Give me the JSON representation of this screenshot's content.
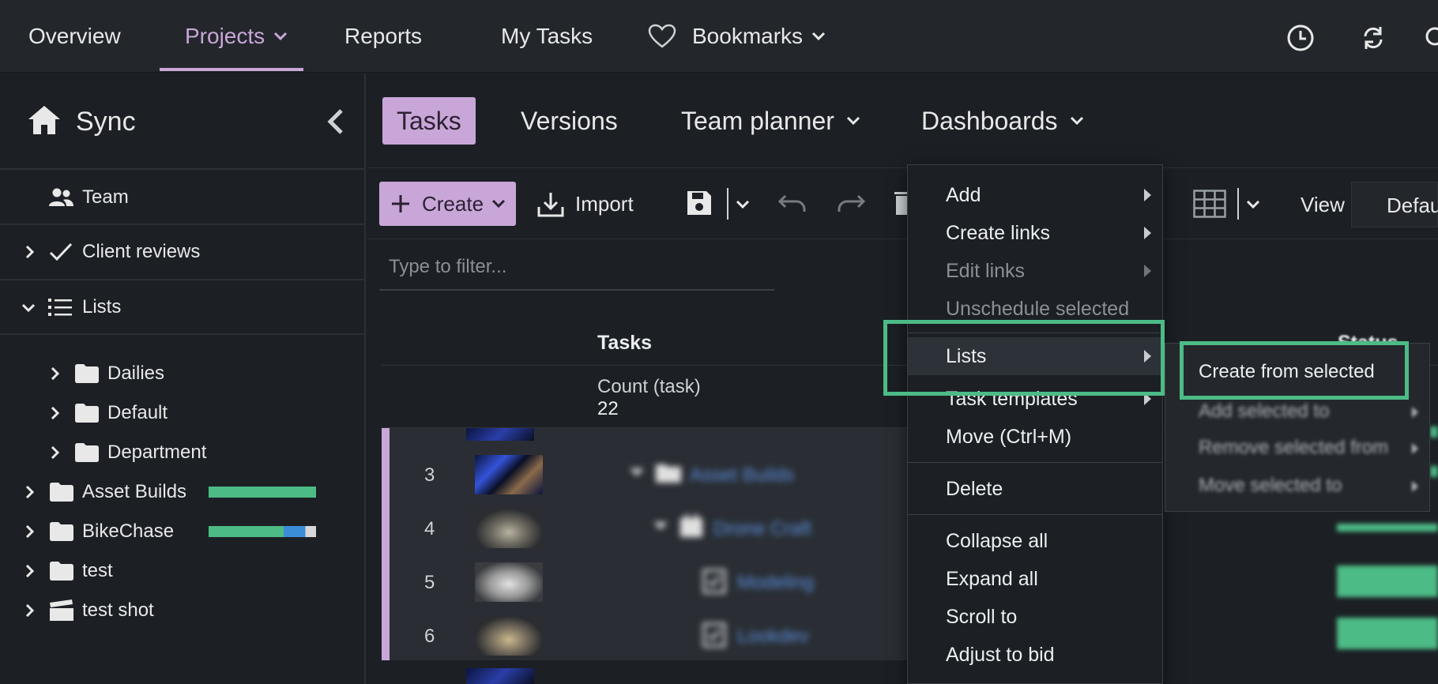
{
  "topnav": {
    "items": [
      "Overview",
      "Projects",
      "Reports",
      "My Tasks",
      "Bookmarks"
    ]
  },
  "sidebar": {
    "project": "Sync",
    "team": "Team",
    "client_reviews": "Client reviews",
    "lists": "Lists",
    "list_folders": [
      "Dailies",
      "Default",
      "Department"
    ],
    "projects": [
      {
        "name": "Asset Builds",
        "bar": [
          {
            "color": "#4dbb86",
            "fraction": 1.0
          }
        ]
      },
      {
        "name": "BikeChase",
        "bar": [
          {
            "color": "#4dbb86",
            "fraction": 0.7
          },
          {
            "color": "#3c8dd8",
            "fraction": 0.2
          },
          {
            "color": "#d8d8d8",
            "fraction": 0.1
          }
        ]
      },
      {
        "name": "test"
      },
      {
        "name": "test shot"
      }
    ]
  },
  "tabs": [
    "Tasks",
    "Versions",
    "Team planner",
    "Dashboards"
  ],
  "toolbar": {
    "create": "Create",
    "import": "Import",
    "view_label": "View",
    "view_value": "Defau"
  },
  "filter": {
    "placeholder": "Type to filter..."
  },
  "grid": {
    "tasks_header": "Tasks",
    "count_label": "Count (task)",
    "count_value": "22",
    "status_header": "Status",
    "rows": [
      {
        "num": "3",
        "name": "Asset Builds"
      },
      {
        "num": "4",
        "name": "Drone Craft"
      },
      {
        "num": "5",
        "name": "Modeling"
      },
      {
        "num": "6",
        "name": "Lookdev"
      }
    ]
  },
  "context_menu": {
    "items": [
      {
        "label": "Add"
      },
      {
        "label": "Create links"
      },
      {
        "label": "Edit links"
      },
      {
        "label": "Unschedule selected"
      },
      {
        "label": "Lists"
      },
      {
        "label": "Task templates"
      },
      {
        "label": "Move (Ctrl+M)"
      },
      {
        "label": "Delete"
      },
      {
        "label": "Collapse all"
      },
      {
        "label": "Expand all"
      },
      {
        "label": "Scroll to"
      },
      {
        "label": "Adjust to bid"
      }
    ]
  },
  "submenu": {
    "items": [
      "Create from selected",
      "Add selected to",
      "Remove selected from",
      "Move selected to"
    ]
  },
  "colors": {
    "accent": "#c9a6d8",
    "highlight": "#4dbb86"
  }
}
